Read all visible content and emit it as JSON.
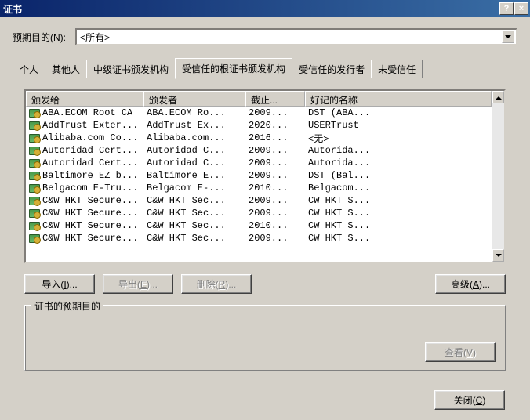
{
  "title": "证书",
  "titlebar": {
    "help": "?",
    "close": "×"
  },
  "purpose": {
    "label_pre": "预期目的(",
    "label_u": "N",
    "label_post": "):",
    "selected": "<所有>"
  },
  "tabs": [
    {
      "label": "个人",
      "active": false
    },
    {
      "label": "其他人",
      "active": false
    },
    {
      "label": "中级证书颁发机构",
      "active": false
    },
    {
      "label": "受信任的根证书颁发机构",
      "active": true
    },
    {
      "label": "受信任的发行者",
      "active": false
    },
    {
      "label": "未受信任",
      "active": false
    }
  ],
  "columns": {
    "issued_to": "颁发给",
    "issuer": "颁发者",
    "expires": "截止...",
    "friendly": "好记的名称"
  },
  "rows": [
    {
      "to": "ABA.ECOM Root CA",
      "by": "ABA.ECOM Ro...",
      "exp": "2009...",
      "fn": "DST (ABA..."
    },
    {
      "to": "AddTrust Exter...",
      "by": "AddTrust Ex...",
      "exp": "2020...",
      "fn": "USERTrust"
    },
    {
      "to": "Alibaba.com Co...",
      "by": "Alibaba.com...",
      "exp": "2016...",
      "fn": "<无>"
    },
    {
      "to": "Autoridad Cert...",
      "by": "Autoridad C...",
      "exp": "2009...",
      "fn": "Autorida..."
    },
    {
      "to": "Autoridad Cert...",
      "by": "Autoridad C...",
      "exp": "2009...",
      "fn": "Autorida..."
    },
    {
      "to": "Baltimore EZ b...",
      "by": "Baltimore E...",
      "exp": "2009...",
      "fn": "DST (Bal..."
    },
    {
      "to": "Belgacom E-Tru...",
      "by": "Belgacom E-...",
      "exp": "2010...",
      "fn": "Belgacom..."
    },
    {
      "to": "C&W HKT Secure...",
      "by": "C&W HKT Sec...",
      "exp": "2009...",
      "fn": "CW HKT S..."
    },
    {
      "to": "C&W HKT Secure...",
      "by": "C&W HKT Sec...",
      "exp": "2009...",
      "fn": "CW HKT S..."
    },
    {
      "to": "C&W HKT Secure...",
      "by": "C&W HKT Sec...",
      "exp": "2010...",
      "fn": "CW HKT S..."
    },
    {
      "to": "C&W HKT Secure...",
      "by": "C&W HKT Sec...",
      "exp": "2009...",
      "fn": "CW HKT S..."
    }
  ],
  "buttons": {
    "import": "导入(I)...",
    "export": "导出(E)...",
    "delete": "删除(R)...",
    "advanced": "高级(A)...",
    "view": "查看(V)",
    "close": "关闭(C)"
  },
  "groupbox_title": "证书的预期目的"
}
